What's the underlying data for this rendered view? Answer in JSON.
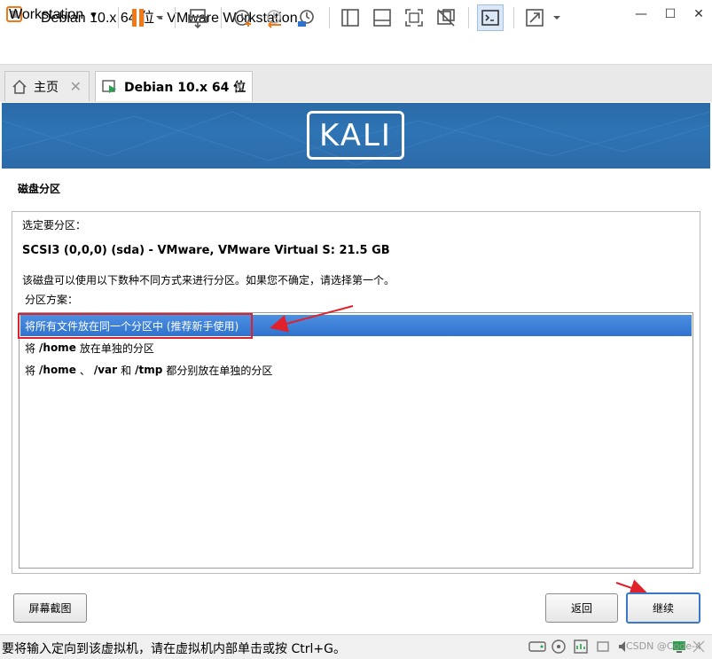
{
  "window": {
    "title": "Debian 10.x 64 位 - VMware Workstation",
    "minimize": "—",
    "maximize": "☐",
    "close": "✕"
  },
  "toolbar": {
    "menu_label": "Workstation",
    "menu_arrow": "▾",
    "icons": [
      "pause-icon",
      "send-ctrl-alt-del-icon",
      "snapshot-take-icon",
      "snapshot-revert-icon",
      "snapshot-manager-icon",
      "sidebar-toggle-icon",
      "thumbnail-bar-icon",
      "fullscreen-icon",
      "unity-icon",
      "console-icon",
      "stretch-icon"
    ]
  },
  "tabs": [
    {
      "label": "主页",
      "close": "✕"
    },
    {
      "label": "Debian 10.x 64 位",
      "close": "✕"
    }
  ],
  "vm": {
    "banner_logo": "KALI",
    "section_title": "磁盘分区",
    "select_label": "选定要分区：",
    "disk_name": "SCSI3 (0,0,0) (sda) - VMware, VMware Virtual S: 21.5 GB",
    "hint": "该磁盘可以使用以下数种不同方式来进行分区。如果您不确定，请选择第一个。",
    "scheme_label": "分区方案：",
    "options": [
      {
        "text": "将所有文件放在同一个分区中 (推荐新手使用)",
        "selected": true
      },
      {
        "pre": "将",
        "bold1": "/home",
        "post": "放在单独的分区"
      },
      {
        "pre": "将",
        "bold1": "/home",
        "mid1": "、",
        "bold2": "/var",
        "mid2": "和",
        "bold3": "/tmp",
        "post": "都分别放在单独的分区"
      }
    ],
    "buttons": {
      "screenshot": "屏幕截图",
      "back": "返回",
      "continue": "继续"
    }
  },
  "annotations": {
    "highlight_color": "#e0212b"
  },
  "statusbar": {
    "text": "要将输入定向到该虚拟机，请在虚拟机内部单击或按 Ctrl+G。",
    "watermark": "CSDN @Code-4"
  },
  "colors": {
    "selection": "#2f73cf",
    "banner": "#2e74b5",
    "pause_orange": "#f07a19"
  }
}
